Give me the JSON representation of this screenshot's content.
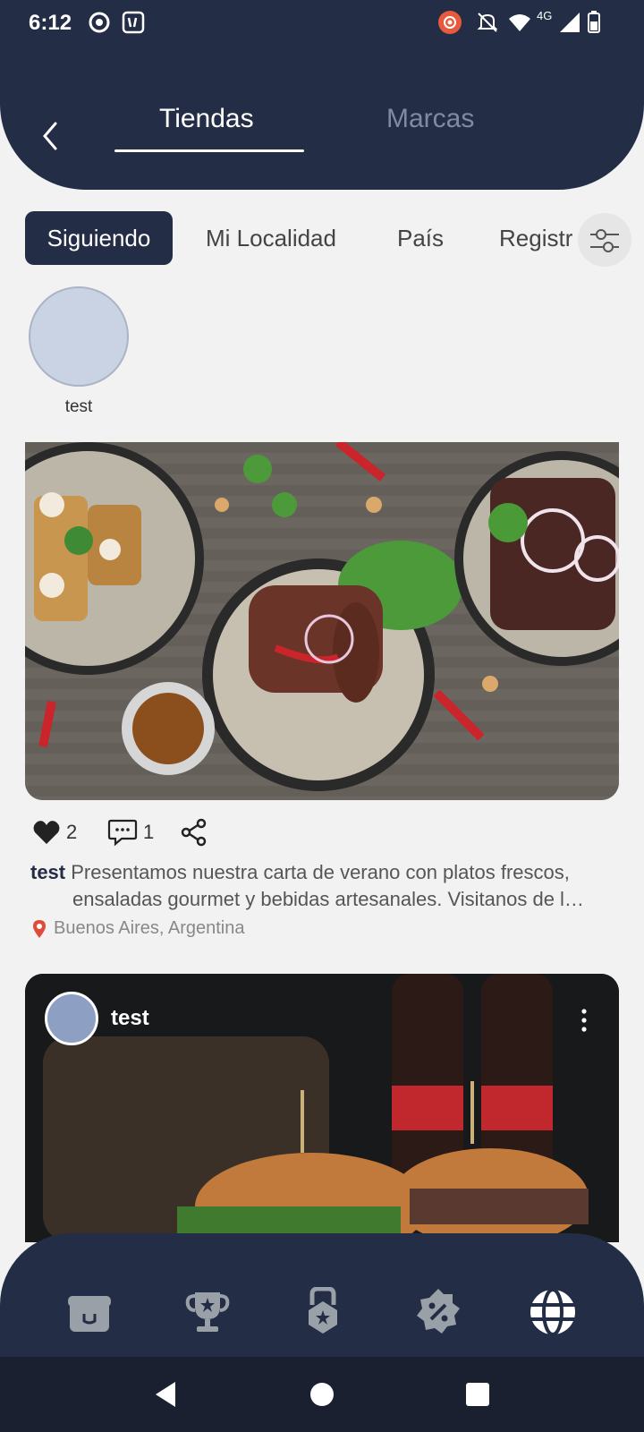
{
  "status_bar": {
    "time": "6:12",
    "network": "4G",
    "icons": [
      "record-icon",
      "voicemail-icon",
      "cast-icon",
      "mute-icon",
      "wifi-icon",
      "signal-icon",
      "battery-icon"
    ]
  },
  "header": {
    "tabs": [
      {
        "label": "Tiendas",
        "active": true
      },
      {
        "label": "Marcas",
        "active": false
      }
    ]
  },
  "filters": {
    "chips": [
      {
        "label": "Siguiendo",
        "selected": true
      },
      {
        "label": "Mi Localidad",
        "selected": false
      },
      {
        "label": "País",
        "selected": false
      },
      {
        "label": "Registr",
        "selected": false
      }
    ]
  },
  "stories": [
    {
      "name": "test"
    }
  ],
  "posts": [
    {
      "user": "test",
      "likes": "2",
      "comments": "1",
      "caption_user": "test",
      "caption_text": "Presentamos nuestra carta de verano con platos frescos,",
      "caption_text_2": "ensaladas gourmet y bebidas artesanales. Visitanos de l…",
      "location": "Buenos Aires, Argentina"
    },
    {
      "user": "test"
    }
  ],
  "bottom_nav": {
    "items": [
      "store-icon",
      "trophy-icon",
      "medal-icon",
      "discount-icon",
      "globe-icon"
    ]
  },
  "colors": {
    "primary": "#232d45",
    "background": "#f2f2f2",
    "inactive_tab": "#7f8aa3"
  }
}
